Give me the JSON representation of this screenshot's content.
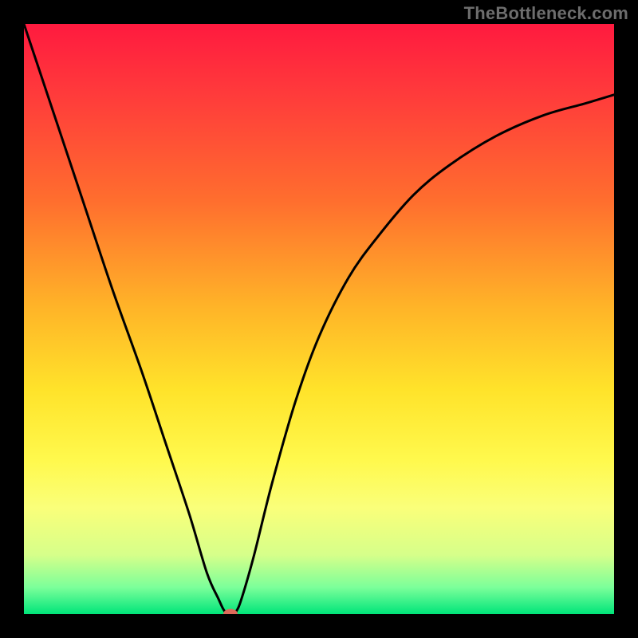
{
  "watermark": "TheBottleneck.com",
  "chart_data": {
    "type": "line",
    "title": "",
    "xlabel": "",
    "ylabel": "",
    "xlim": [
      0,
      100
    ],
    "ylim": [
      0,
      100
    ],
    "grid": false,
    "legend": false,
    "background_gradient_stops": [
      {
        "offset": 0.0,
        "color": "#ff1a3f"
      },
      {
        "offset": 0.12,
        "color": "#ff3b3b"
      },
      {
        "offset": 0.3,
        "color": "#ff6e2e"
      },
      {
        "offset": 0.48,
        "color": "#ffb428"
      },
      {
        "offset": 0.62,
        "color": "#ffe32a"
      },
      {
        "offset": 0.74,
        "color": "#fff94d"
      },
      {
        "offset": 0.82,
        "color": "#faff7a"
      },
      {
        "offset": 0.9,
        "color": "#d6ff8a"
      },
      {
        "offset": 0.955,
        "color": "#7bff9a"
      },
      {
        "offset": 1.0,
        "color": "#00e57a"
      }
    ],
    "curve_points": [
      {
        "x": 0,
        "y": 100
      },
      {
        "x": 5,
        "y": 85
      },
      {
        "x": 10,
        "y": 70
      },
      {
        "x": 15,
        "y": 55
      },
      {
        "x": 20,
        "y": 41
      },
      {
        "x": 24,
        "y": 29
      },
      {
        "x": 28,
        "y": 17
      },
      {
        "x": 31,
        "y": 7
      },
      {
        "x": 33,
        "y": 2.5
      },
      {
        "x": 34,
        "y": 0.5
      },
      {
        "x": 35,
        "y": 0
      },
      {
        "x": 36,
        "y": 0.5
      },
      {
        "x": 37,
        "y": 3
      },
      {
        "x": 39,
        "y": 10
      },
      {
        "x": 42,
        "y": 22
      },
      {
        "x": 46,
        "y": 36
      },
      {
        "x": 50,
        "y": 47
      },
      {
        "x": 55,
        "y": 57
      },
      {
        "x": 60,
        "y": 64
      },
      {
        "x": 66,
        "y": 71
      },
      {
        "x": 72,
        "y": 76
      },
      {
        "x": 80,
        "y": 81
      },
      {
        "x": 88,
        "y": 84.5
      },
      {
        "x": 95,
        "y": 86.5
      },
      {
        "x": 100,
        "y": 88
      }
    ],
    "marker": {
      "x": 35,
      "y": 0,
      "color": "#dd6a5a"
    },
    "curve_color": "#000000",
    "curve_width": 3
  }
}
